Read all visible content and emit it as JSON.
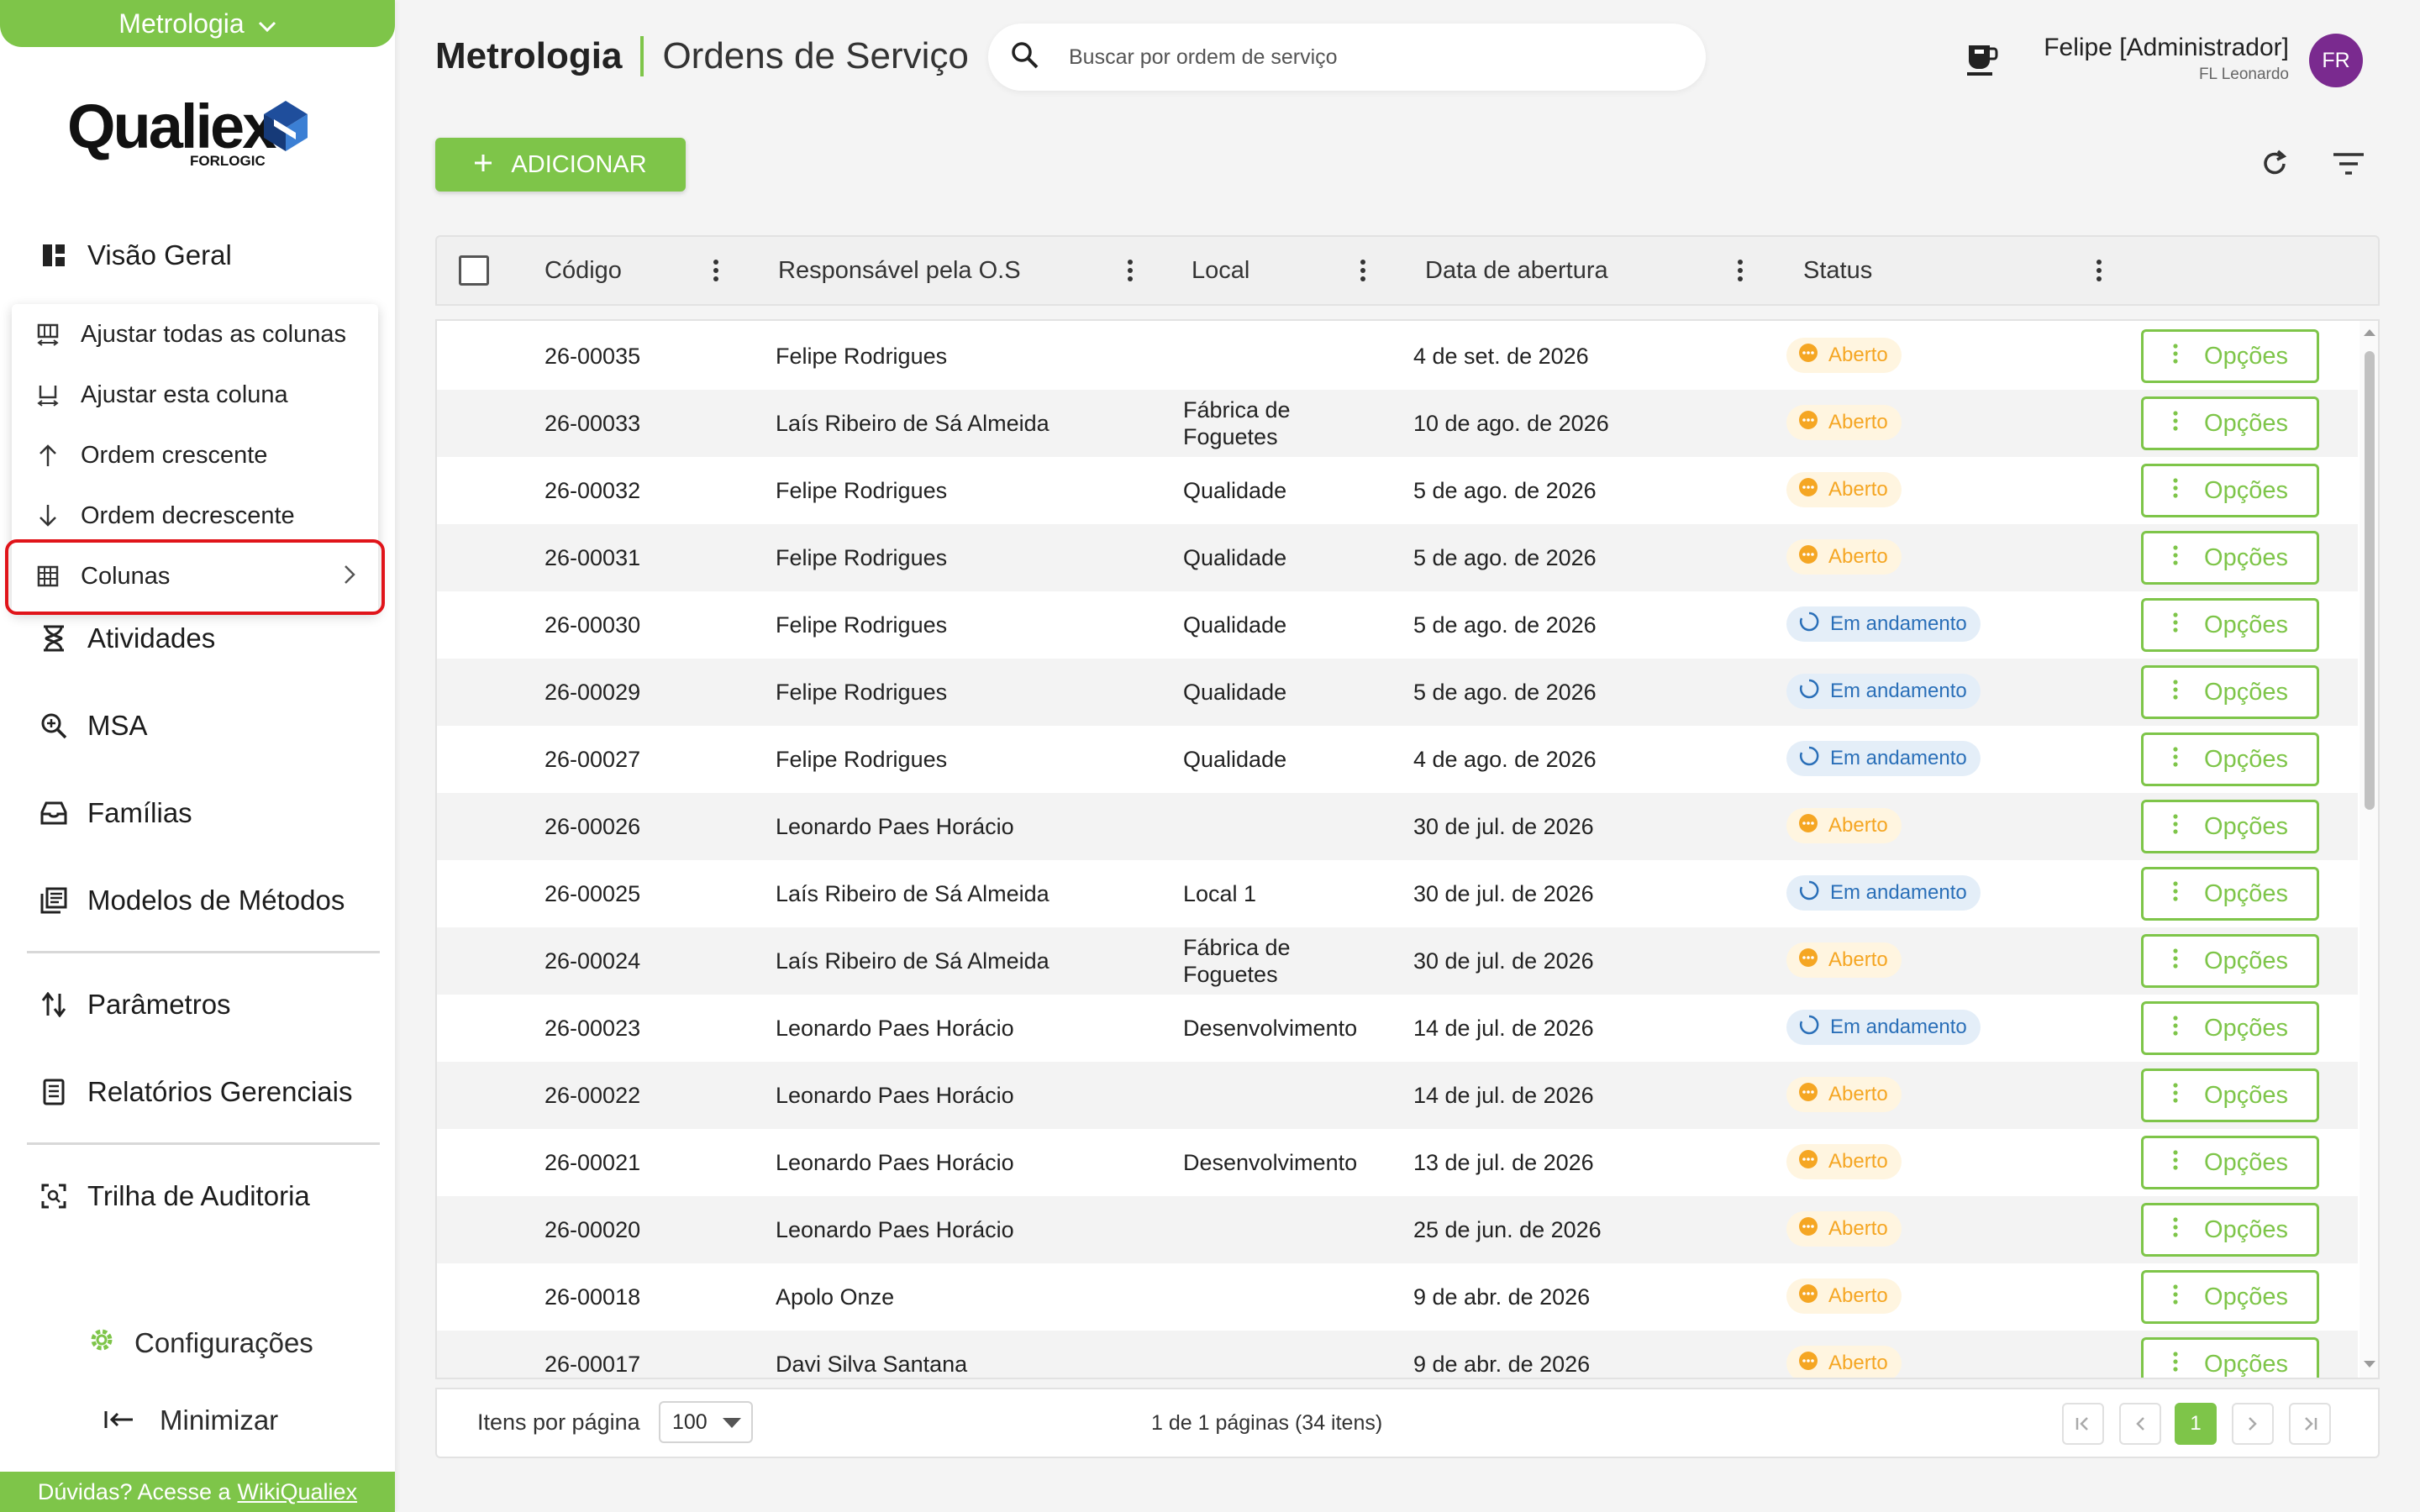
{
  "module_switch": {
    "label": "Metrologia"
  },
  "logo": {
    "word": "Qualiex",
    "sub": "FORLOGIC"
  },
  "sidebar": {
    "items": [
      {
        "label": "Visão Geral",
        "icon": "dashboard-icon"
      },
      {
        "label": "Atividades",
        "icon": "hourglass-icon"
      },
      {
        "label": "MSA",
        "icon": "zoom-icon"
      },
      {
        "label": "Famílias",
        "icon": "inbox-icon"
      },
      {
        "label": "Modelos de Métodos",
        "icon": "library-icon"
      },
      {
        "label": "Parâmetros",
        "icon": "sort-icon"
      },
      {
        "label": "Relatórios Gerenciais",
        "icon": "report-icon"
      },
      {
        "label": "Trilha de Auditoria",
        "icon": "audit-icon"
      }
    ],
    "config_label": "Configurações",
    "minimize_label": "Minimizar",
    "help_prefix": "Dúvidas? Acesse a",
    "help_link": "WikiQualiex"
  },
  "context_menu": {
    "items": [
      {
        "label": "Ajustar todas as colunas"
      },
      {
        "label": "Ajustar esta coluna"
      },
      {
        "label": "Ordem crescente"
      },
      {
        "label": "Ordem decrescente"
      },
      {
        "label": "Colunas"
      }
    ]
  },
  "header": {
    "module": "Metrologia",
    "page": "Ordens de Serviço",
    "search_placeholder": "Buscar por ordem de serviço",
    "user_name": "Felipe [Administrador]",
    "user_sub": "FL Leonardo",
    "avatar": "FR"
  },
  "toolbar": {
    "add_label": "ADICIONAR"
  },
  "table": {
    "columns": [
      "Código",
      "Responsável pela O.S",
      "Local",
      "Data de abertura",
      "Status"
    ],
    "option_label": "Opções",
    "rows": [
      {
        "code": "26-00035",
        "resp": "Felipe Rodrigues",
        "local": "",
        "date": "4 de set. de 2026",
        "status": "Aberto",
        "kind": "open"
      },
      {
        "code": "26-00033",
        "resp": "Laís Ribeiro de Sá Almeida",
        "local": "Fábrica de\nFoguetes",
        "date": "10 de ago. de 2026",
        "status": "Aberto",
        "kind": "open"
      },
      {
        "code": "26-00032",
        "resp": "Felipe Rodrigues",
        "local": "Qualidade",
        "date": "5 de ago. de 2026",
        "status": "Aberto",
        "kind": "open"
      },
      {
        "code": "26-00031",
        "resp": "Felipe Rodrigues",
        "local": "Qualidade",
        "date": "5 de ago. de 2026",
        "status": "Aberto",
        "kind": "open"
      },
      {
        "code": "26-00030",
        "resp": "Felipe Rodrigues",
        "local": "Qualidade",
        "date": "5 de ago. de 2026",
        "status": "Em andamento",
        "kind": "progress"
      },
      {
        "code": "26-00029",
        "resp": "Felipe Rodrigues",
        "local": "Qualidade",
        "date": "5 de ago. de 2026",
        "status": "Em andamento",
        "kind": "progress"
      },
      {
        "code": "26-00027",
        "resp": "Felipe Rodrigues",
        "local": "Qualidade",
        "date": "4 de ago. de 2026",
        "status": "Em andamento",
        "kind": "progress"
      },
      {
        "code": "26-00026",
        "resp": "Leonardo Paes Horácio",
        "local": "",
        "date": "30 de jul. de 2026",
        "status": "Aberto",
        "kind": "open"
      },
      {
        "code": "26-00025",
        "resp": "Laís Ribeiro de Sá Almeida",
        "local": "Local 1",
        "date": "30 de jul. de 2026",
        "status": "Em andamento",
        "kind": "progress"
      },
      {
        "code": "26-00024",
        "resp": "Laís Ribeiro de Sá Almeida",
        "local": "Fábrica de\nFoguetes",
        "date": "30 de jul. de 2026",
        "status": "Aberto",
        "kind": "open"
      },
      {
        "code": "26-00023",
        "resp": "Leonardo Paes Horácio",
        "local": "Desenvolvimento",
        "date": "14 de jul. de 2026",
        "status": "Em andamento",
        "kind": "progress"
      },
      {
        "code": "26-00022",
        "resp": "Leonardo Paes Horácio",
        "local": "",
        "date": "14 de jul. de 2026",
        "status": "Aberto",
        "kind": "open"
      },
      {
        "code": "26-00021",
        "resp": "Leonardo Paes Horácio",
        "local": "Desenvolvimento",
        "date": "13 de jul. de 2026",
        "status": "Aberto",
        "kind": "open"
      },
      {
        "code": "26-00020",
        "resp": "Leonardo Paes Horácio",
        "local": "",
        "date": "25 de jun. de 2026",
        "status": "Aberto",
        "kind": "open"
      },
      {
        "code": "26-00018",
        "resp": "Apolo Onze",
        "local": "",
        "date": "9 de abr. de 2026",
        "status": "Aberto",
        "kind": "open"
      },
      {
        "code": "26-00017",
        "resp": "Davi Silva Santana",
        "local": "",
        "date": "9 de abr. de 2026",
        "status": "Aberto",
        "kind": "open"
      }
    ]
  },
  "pagination": {
    "items_label": "Itens por página",
    "page_size": "100",
    "summary": "1 de 1 páginas (34 itens)",
    "current_page": "1"
  },
  "colors": {
    "accent": "#7ec549",
    "open": "#f5a623",
    "progress": "#2a6fb8",
    "highlight": "#e0141a"
  }
}
